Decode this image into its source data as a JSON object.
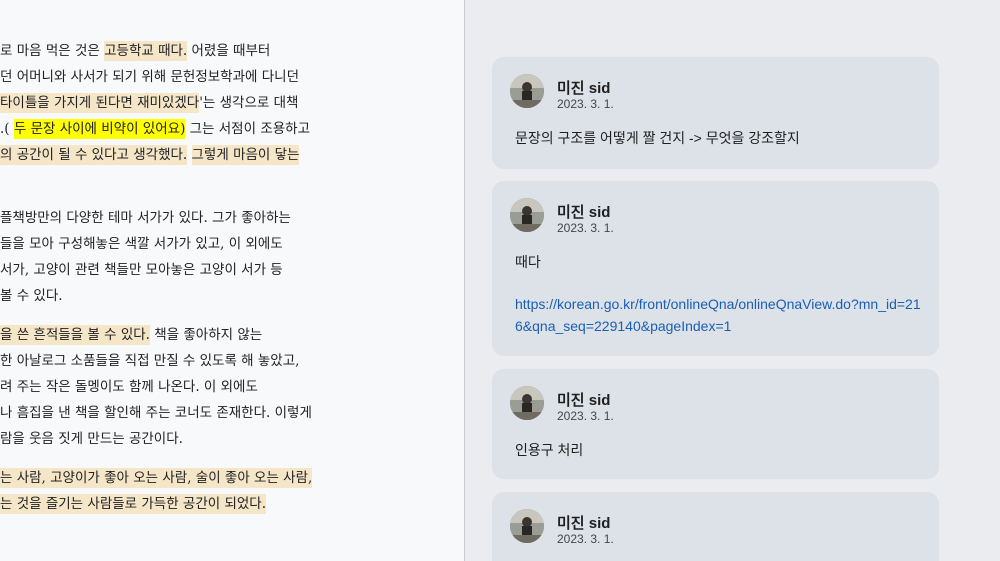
{
  "document": {
    "lines": [
      [
        {
          "t": "로 마음 먹은 것은 "
        },
        {
          "t": "고등학교 때다.",
          "h": "hl"
        },
        {
          "t": " 어렸을 때부터"
        }
      ],
      [
        {
          "t": "던 어머니와 사서가 되기 위해 문헌정보학과에 다니던"
        }
      ],
      [
        {
          "t": "타이틀을 가지게 된다면 재미있겠다",
          "h": "hl"
        },
        {
          "t": "'는 생각으로 대책"
        }
      ],
      [
        {
          "t": ".( "
        },
        {
          "t": "두 문장 사이에 비약이 있어요)",
          "h": "hy"
        },
        {
          "t": " 그는 서점이 조용하고"
        }
      ],
      [
        {
          "t": "의 공간이 될 수 있다고 생각했다.",
          "h": "hl"
        },
        {
          "t": " "
        },
        {
          "t": "그렇게 마음이 닿는",
          "h": "hl"
        }
      ],
      [
        {
          "t": "플책방만의 다양한 테마 서가가 있다. 그가 좋아하는"
        }
      ],
      [
        {
          "t": "들을 모아 구성해놓은 색깔 서가가 있고, 이 외에도"
        }
      ],
      [
        {
          "t": "서가, 고양이 관련 책들만 모아놓은 고양이 서가 등"
        }
      ],
      [
        {
          "t": "볼 수 있다."
        }
      ],
      [
        {
          "t": "을 쓴 흔적들을 볼 수 있다.",
          "h": "hl"
        },
        {
          "t": " 책을 좋아하지 않는"
        }
      ],
      [
        {
          "t": "한 아날로그 소품들을 직접 만질 수 있도록 해 놓았고,"
        }
      ],
      [
        {
          "t": "려 주는 작은 돌멩이도 함께 나온다. 이 외에도"
        }
      ],
      [
        {
          "t": "나 흠집을 낸 책을 할인해 주는 코너도 존재한다. 이렇게"
        }
      ],
      [
        {
          "t": "람을 웃음 짓게 만드는 공간이다."
        }
      ],
      [
        {
          "t": "는 사람, 고양이가 좋아 오는 사람, 술이 좋아 오는 사람,",
          "h": "hl"
        }
      ],
      [
        {
          "t": "는 것을 즐기는 사람들로 가득한 공간이 되었다.",
          "h": "hl"
        }
      ]
    ]
  },
  "comments": [
    {
      "name": "미진 sid",
      "date": "2023. 3. 1.",
      "text": "문장의 구조를 어떻게 짤 건지 -> 무엇을 강조할지",
      "link": ""
    },
    {
      "name": "미진 sid",
      "date": "2023. 3. 1.",
      "text": "때다",
      "link": "https://korean.go.kr/front/onlineQna/onlineQnaView.do?mn_id=216&qna_seq=229140&pageIndex=1"
    },
    {
      "name": "미진 sid",
      "date": "2023. 3. 1.",
      "text": "인용구 처리",
      "link": ""
    },
    {
      "name": "미진 sid",
      "date": "2023. 3. 1.",
      "text": "",
      "link": ""
    }
  ]
}
